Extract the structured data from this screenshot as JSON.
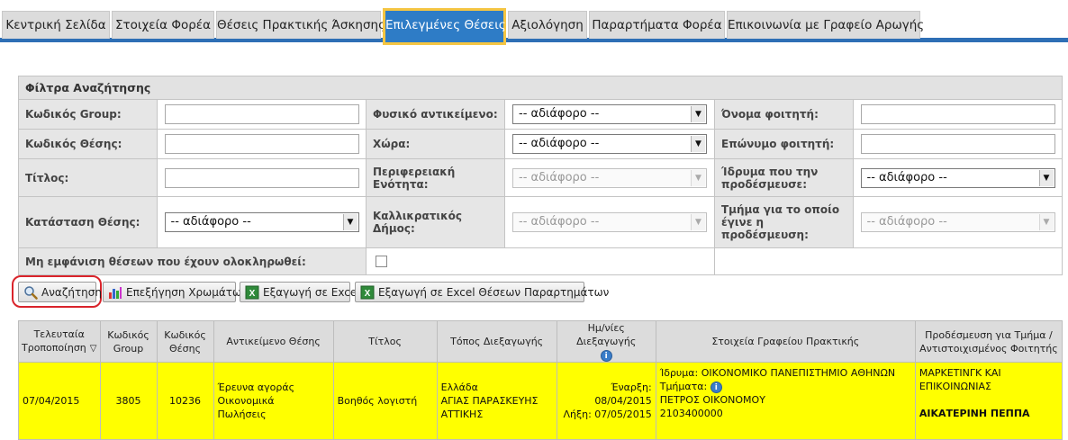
{
  "tabs": [
    {
      "label": "Κεντρική Σελίδα"
    },
    {
      "label": "Στοιχεία Φορέα"
    },
    {
      "label": "Θέσεις Πρακτικής Άσκησης"
    },
    {
      "label": "Επιλεγμένες Θέσεις"
    },
    {
      "label": "Αξιολόγηση"
    },
    {
      "label": "Παραρτήματα Φορέα"
    },
    {
      "label": "Επικοινωνία με Γραφείο Αρωγής"
    }
  ],
  "filters": {
    "title": "Φίλτρα Αναζήτησης",
    "group_code_label": "Κωδικός Group:",
    "position_code_label": "Κωδικός Θέσης:",
    "title_label": "Τίτλος:",
    "status_label": "Κατάσταση Θέσης:",
    "status_value": "-- αδιάφορο --",
    "physical_object_label": "Φυσικό αντικείμενο:",
    "physical_object_value": "-- αδιάφορο --",
    "country_label": "Χώρα:",
    "country_value": "-- αδιάφορο --",
    "regional_unit_label": "Περιφερειακή Ενότητα:",
    "regional_unit_value": "-- αδιάφορο --",
    "municipality_label": "Καλλικρατικός Δήμος:",
    "municipality_value": "-- αδιάφορο --",
    "student_first_name_label": "Όνομα φοιτητή:",
    "student_last_name_label": "Επώνυμο φοιτητή:",
    "institution_label": "Ίδρυμα που την προδέσμευσε:",
    "institution_value": "-- αδιάφορο --",
    "department_label": "Τμήμα για το οποίο έγινε η προδέσμευση:",
    "department_value": "-- αδιάφορο --",
    "hide_completed_label": "Μη εμφάνιση θέσεων που έχουν ολοκληρωθεί:"
  },
  "buttons": {
    "search": "Αναζήτηση",
    "color_legend": "Επεξήγηση Χρωμάτων",
    "export_excel": "Εξαγωγή σε Excel",
    "export_excel_branches": "Εξαγωγή σε Excel Θέσεων Παραρτημάτων"
  },
  "table": {
    "headers": {
      "last_modified": "Τελευταία Τροποποίηση",
      "group_code": "Κωδικός Group",
      "position_code": "Κωδικός Θέσης",
      "subject": "Αντικείμενο Θέσης",
      "title": "Τίτλος",
      "location": "Τόπος Διεξαγωγής",
      "dates": "Ημ/νίες Διεξαγωγής",
      "office_info": "Στοιχεία Γραφείου Πρακτικής",
      "preassignment": "Προδέσμευση για Τμήμα / Αντιστοιχισμένος Φοιτητής"
    },
    "row": {
      "last_modified": "07/04/2015",
      "group_code": "3805",
      "position_code": "10236",
      "subject_1": "Έρευνα αγοράς",
      "subject_2": "Οικονομικά",
      "subject_3": "Πωλήσεις",
      "title": "Βοηθός λογιστή",
      "location_1": "Ελλάδα",
      "location_2": "ΑΓΙΑΣ ΠΑΡΑΣΚΕΥΗΣ",
      "location_3": "ΑΤΤΙΚΗΣ",
      "start": "Έναρξη: 08/04/2015",
      "end": "Λήξη: 07/05/2015",
      "office_institution": "Ίδρυμα: ΟΙΚΟΝΟΜΙΚΟ ΠΑΝΕΠΙΣΤΗΜΙΟ ΑΘΗΝΩΝ",
      "office_departments": "Τμήματα:",
      "office_contact": "ΠΕΤΡΟΣ ΟΙΚΟΝΟΜΟΥ",
      "office_phone": "2103400000",
      "department_1": "ΜΑΡΚΕΤΙΝΓΚ ΚΑΙ",
      "department_2": "ΕΠΙΚΟΙΝΩΝΙΑΣ",
      "student": "ΑΙΚΑΤΕΡΙΝΗ ΠΕΠΠΑ"
    }
  },
  "colors": {
    "tab_active": "#2e7cc6",
    "tab_active_border": "#f5c542",
    "row_highlight": "#ffff00",
    "search_highlight": "#d9242b"
  },
  "icons": [
    "search-icon",
    "color-chart-icon",
    "excel-icon",
    "info-icon",
    "sort-desc-icon",
    "dropdown-arrow-icon"
  ]
}
